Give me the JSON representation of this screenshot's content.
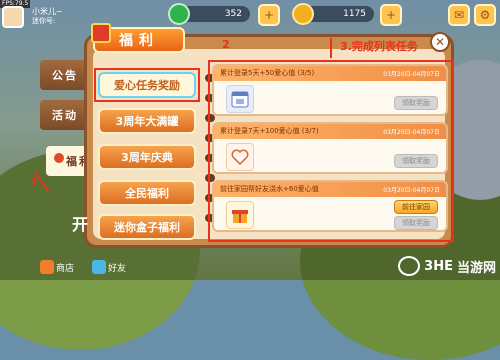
{
  "fps": "FPS:79.5",
  "player": {
    "name": "小米儿~",
    "id": "迷你号:"
  },
  "resources": [
    {
      "name": "green-gem",
      "value": "352",
      "color": "#2fb34a"
    },
    {
      "name": "gold-coin",
      "value": "1175",
      "color": "#f2b01e"
    }
  ],
  "side_tabs": [
    {
      "label": "公告",
      "active": false
    },
    {
      "label": "活动",
      "active": false
    },
    {
      "label": "福利",
      "active": true
    }
  ],
  "panel": {
    "title": "福利"
  },
  "sub_list": [
    {
      "label": "爱心任务奖励",
      "active": true
    },
    {
      "label": "3周年大满罐",
      "active": false
    },
    {
      "label": "3周年庆典",
      "active": false
    },
    {
      "label": "全民福利",
      "active": false
    },
    {
      "label": "迷你盒子福利",
      "active": false
    }
  ],
  "tasks": [
    {
      "title": "累计登录5天+50爱心值 (3/5)",
      "date": "03月20日-04月07日",
      "button": "领取奖励",
      "icon": "calendar-icon"
    },
    {
      "title": "累计登录7天+100爱心值 (3/7)",
      "date": "03月20日-04月07日",
      "button": "领取奖励",
      "icon": "heart-frame-icon"
    },
    {
      "title": "前往家园帮好友浇水+60爱心值",
      "date": "03月20日-04月07日",
      "button_go": "前往家园",
      "button": "领取奖励",
      "icon": "gift-box-icon"
    }
  ],
  "annotations": {
    "a1": "1",
    "a2": "2",
    "a3": "3.完成列表任务"
  },
  "bottom": {
    "shop": "商店",
    "friends": "好友",
    "start": "开"
  },
  "watermark": {
    "logo": "3HE",
    "text": "当游网"
  },
  "colors": {
    "accent": "#e8641a",
    "annotation": "#e8321e",
    "panel": "#c98a4b"
  }
}
